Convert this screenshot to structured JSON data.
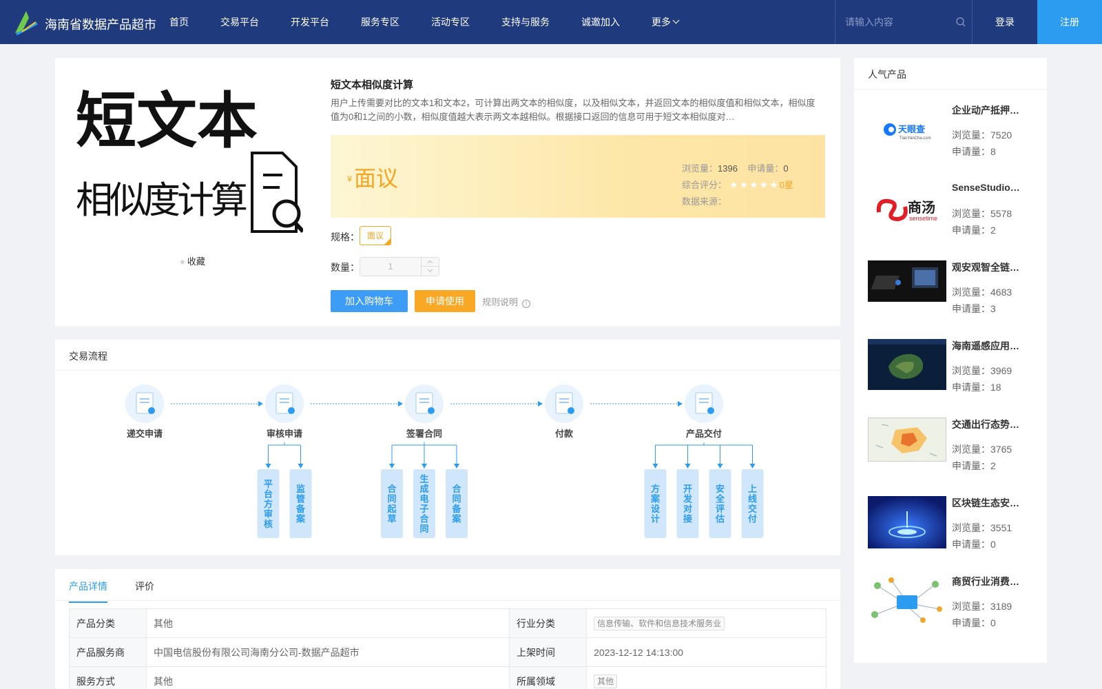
{
  "header": {
    "site_name": "海南省数据产品超市",
    "nav": [
      "首页",
      "交易平台",
      "开发平台",
      "服务专区",
      "活动专区",
      "支持与服务",
      "诚邀加入",
      "更多"
    ],
    "search_placeholder": "请输入内容",
    "login": "登录",
    "register": "注册",
    "colors": {
      "bar": "#1f3a7d",
      "register": "#2c9cf0"
    }
  },
  "product": {
    "image_text_line1": "短文本",
    "image_text_line2": "相似度计算",
    "favorite": "收藏",
    "title": "短文本相似度计算",
    "description": "用户上传需要对比的文本1和文本2，可计算出两文本的相似度，以及相似文本，并返回文本的相似度值和相似文本，相似度值为0和1之间的小数，相似度值越大表示两文本越相似。根据接口返回的信息可用于短文本相似度对…",
    "currency": "¥",
    "price": "面议",
    "views_label": "浏览量：",
    "views": "1396",
    "applies_label": "申请量：",
    "applies": "0",
    "rating_label": "综合评分：",
    "rating_stars": "★★★★★",
    "rating_text": "0星",
    "rating_value": 0,
    "source_label": "数据来源：",
    "spec_label": "规格：",
    "spec_option": "面议",
    "qty_label": "数量：",
    "qty_value": "1",
    "cart_button": "加入购物车",
    "apply_button": "申请使用",
    "rules": "规则说明",
    "colors": {
      "accent": "#f5a623",
      "cart": "#3d9cf5",
      "apply": "#f8a825"
    }
  },
  "flow": {
    "title": "交易流程",
    "steps": [
      {
        "label": "递交申请",
        "icon": "form-icon",
        "subs": []
      },
      {
        "label": "审核申请",
        "icon": "review-icon",
        "subs": [
          "平台方审核",
          "监管备案"
        ]
      },
      {
        "label": "签署合同",
        "icon": "sign-icon",
        "subs": [
          "合同起草",
          "生成电子合同",
          "合同备案"
        ]
      },
      {
        "label": "付款",
        "icon": "payment-icon",
        "subs": []
      },
      {
        "label": "产品交付",
        "icon": "delivery-icon",
        "subs": [
          "方案设计",
          "开发对接",
          "安全评估",
          "上线交付"
        ]
      }
    ]
  },
  "detail": {
    "tabs": [
      "产品详情",
      "评价"
    ],
    "rows": [
      {
        "k1": "产品分类",
        "v1": "其他",
        "k2": "行业分类",
        "v2": "信息传输、软件和信息技术服务业",
        "v2_tag": true
      },
      {
        "k1": "产品服务商",
        "v1": "中国电信股份有限公司海南分公司-数据产品超市",
        "k2": "上架时间",
        "v2": "2023-12-12 14:13:00",
        "v2_tag": false
      },
      {
        "k1": "服务方式",
        "v1": "其他",
        "k2": "所属领域",
        "v2": "其他",
        "v2_tag": true
      }
    ]
  },
  "sidebar": {
    "title": "人气产品",
    "views_label": "浏览量：",
    "applies_label": "申请量：",
    "items": [
      {
        "name": "企业动产抵押…",
        "views": "7520",
        "applies": "8",
        "thumb": "tianyancha-logo",
        "logo_text": "天眼查",
        "logo_sub": "TianYanCha.com"
      },
      {
        "name": "SenseStudio…",
        "views": "5578",
        "applies": "2",
        "thumb": "sensetime-logo",
        "logo_text": "商汤",
        "logo_sub": "sensetime"
      },
      {
        "name": "观安观智全链…",
        "views": "4683",
        "applies": "3",
        "thumb": "device-photo"
      },
      {
        "name": "海南遥感应用…",
        "views": "3969",
        "applies": "18",
        "thumb": "satellite-map"
      },
      {
        "name": "交通出行态势…",
        "views": "3765",
        "applies": "2",
        "thumb": "heat-map"
      },
      {
        "name": "区块链生态安…",
        "views": "3551",
        "applies": "0",
        "thumb": "blockchain-art"
      },
      {
        "name": "商贸行业消费…",
        "views": "3189",
        "applies": "0",
        "thumb": "network-diagram"
      }
    ]
  }
}
